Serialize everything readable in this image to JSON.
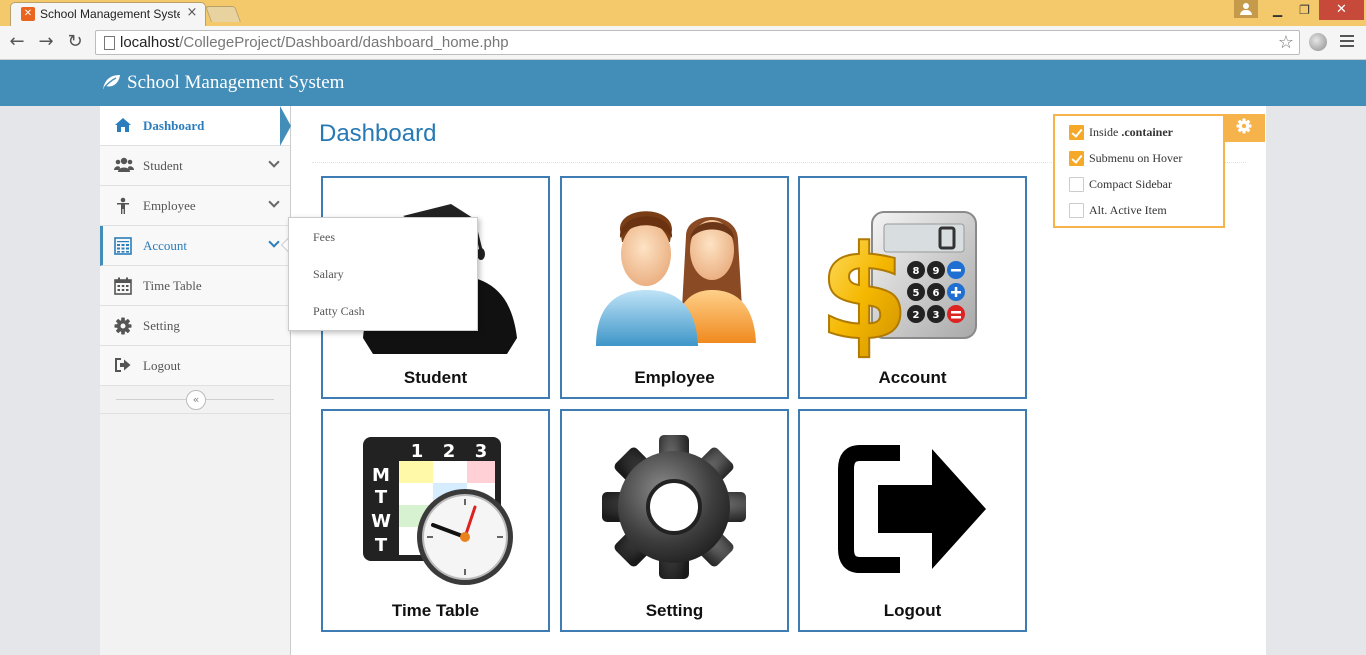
{
  "browser": {
    "tab_title": "School Management System",
    "tab_favicon": "xampp-icon",
    "url_host": "localhost",
    "url_path": "/CollegeProject/Dashboard/dashboard_home.php"
  },
  "header": {
    "brand": "School Management System",
    "brand_icon": "leaf-icon"
  },
  "sidebar": {
    "items": [
      {
        "label": "Dashboard",
        "icon": "home-icon",
        "state": "active"
      },
      {
        "label": "Student",
        "icon": "users-icon",
        "has_submenu": true
      },
      {
        "label": "Employee",
        "icon": "person-icon",
        "has_submenu": true
      },
      {
        "label": "Account",
        "icon": "calculator-icon",
        "has_submenu": true,
        "state": "open"
      },
      {
        "label": "Time Table",
        "icon": "calendar-icon"
      },
      {
        "label": "Setting",
        "icon": "gear-icon"
      },
      {
        "label": "Logout",
        "icon": "signout-icon"
      }
    ],
    "account_submenu": [
      "Fees",
      "Salary",
      "Patty Cash"
    ]
  },
  "page": {
    "title": "Dashboard"
  },
  "tiles": [
    {
      "label": "Student",
      "image": "graduate-image"
    },
    {
      "label": "Employee",
      "image": "people-image"
    },
    {
      "label": "Account",
      "image": "calculator-dollar-image"
    },
    {
      "label": "Time Table",
      "image": "timetable-clock-image"
    },
    {
      "label": "Setting",
      "image": "gear-image"
    },
    {
      "label": "Logout",
      "image": "logout-arrow-image"
    }
  ],
  "ace_settings": {
    "options": [
      {
        "label_prefix": "Inside ",
        "label_bold": ".container",
        "checked": true
      },
      {
        "label_prefix": "Submenu on Hover",
        "label_bold": "",
        "checked": true
      },
      {
        "label_prefix": "Compact Sidebar",
        "label_bold": "",
        "checked": false
      },
      {
        "label_prefix": "Alt. Active Item",
        "label_bold": "",
        "checked": false
      }
    ]
  },
  "colors": {
    "header": "#438eb9",
    "accent": "#2679b5",
    "tile_border": "#3f7cb3",
    "settings_accent": "#f6b34b",
    "browser_frame": "#f3c96b"
  }
}
